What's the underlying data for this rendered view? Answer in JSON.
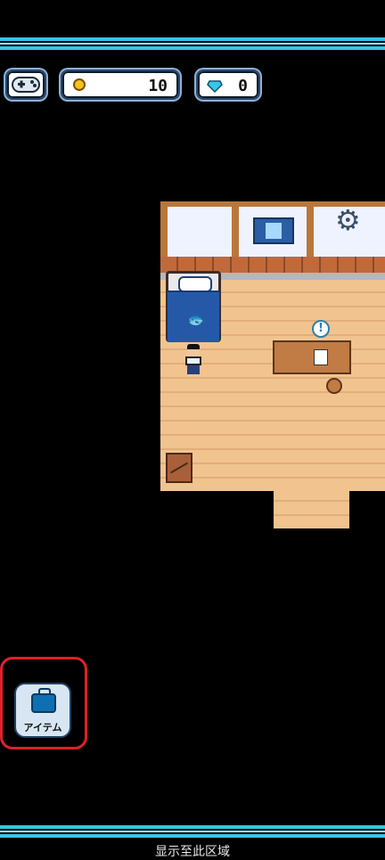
{
  "hud": {
    "coins": "10",
    "gems": "0"
  },
  "icons": {
    "gamepad": "gamepad-icon",
    "coin": "coin-icon",
    "gem": "gem-icon",
    "settings": "gear-icon",
    "bag": "bag-icon",
    "alert": "exclamation-icon"
  },
  "room": {
    "alert_glyph": "!"
  },
  "item_button": {
    "label": "アイテム"
  },
  "footer": {
    "text": "显示至此区域"
  },
  "colors": {
    "accent": "#35c6e6",
    "highlight": "#e0202a"
  }
}
